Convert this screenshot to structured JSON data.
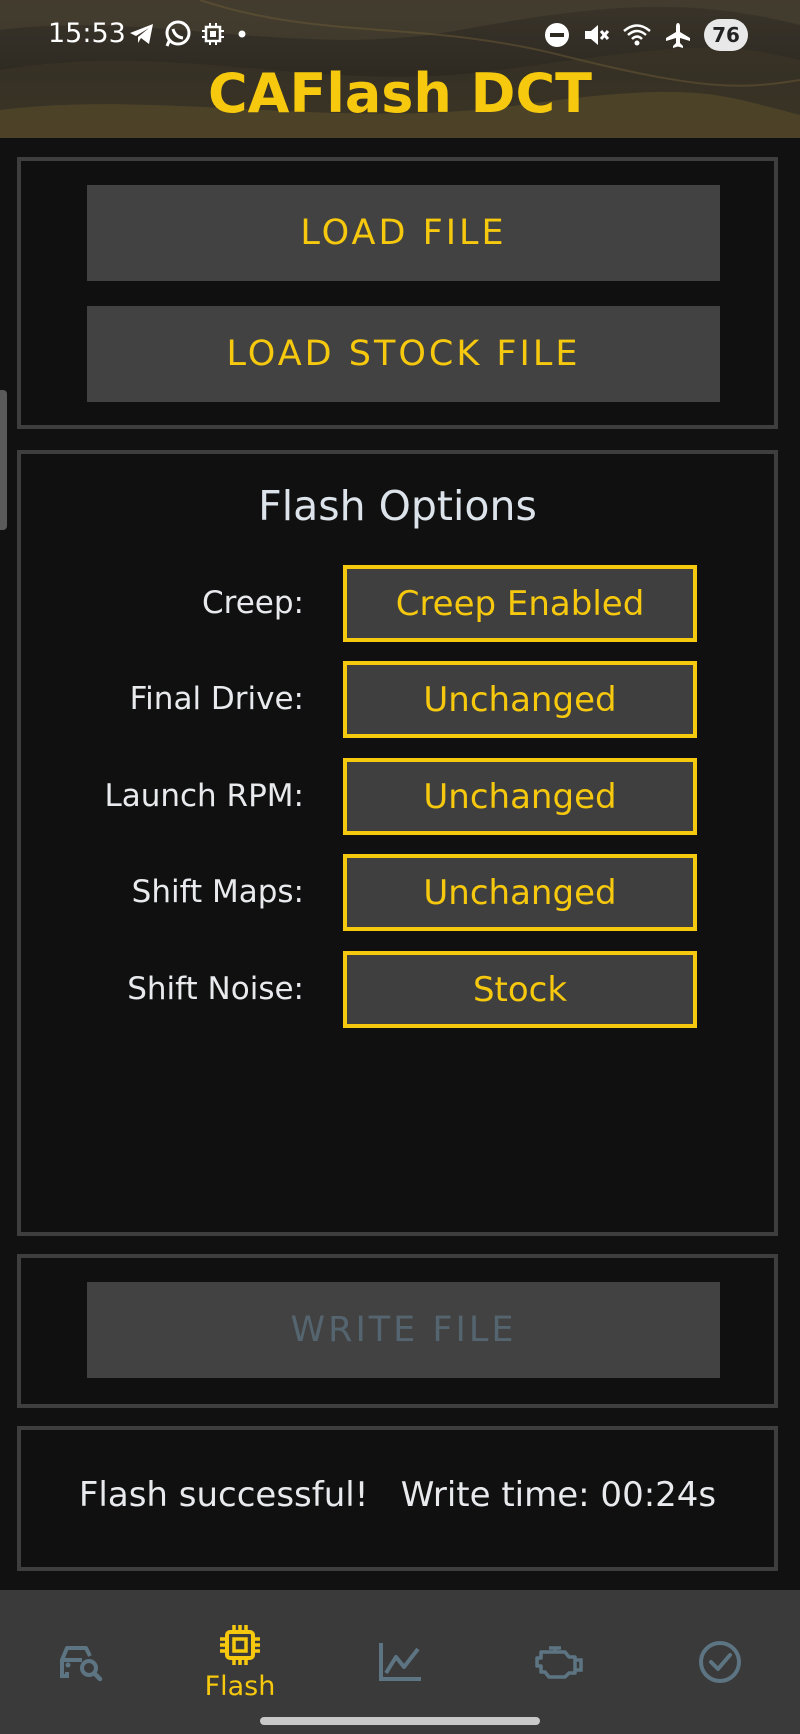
{
  "status_bar": {
    "time": "15:53",
    "battery": "76"
  },
  "app": {
    "title": "CAFlash DCT"
  },
  "file_panel": {
    "load_file": "LOAD FILE",
    "load_stock_file": "LOAD STOCK FILE"
  },
  "flash_options": {
    "title": "Flash Options",
    "options": [
      {
        "label": "Creep:",
        "value": "Creep Enabled"
      },
      {
        "label": "Final Drive:",
        "value": "Unchanged"
      },
      {
        "label": "Launch RPM:",
        "value": "Unchanged"
      },
      {
        "label": "Shift Maps:",
        "value": "Unchanged"
      },
      {
        "label": "Shift Noise:",
        "value": "Stock"
      }
    ]
  },
  "write_panel": {
    "write_file": "WRITE FILE"
  },
  "status_panel": {
    "message": "Flash successful!   Write time: 00:24s"
  },
  "bottom_nav": {
    "items": [
      {
        "icon": "car-search-icon",
        "label": ""
      },
      {
        "icon": "chip-icon",
        "label": "Flash"
      },
      {
        "icon": "chart-icon",
        "label": ""
      },
      {
        "icon": "engine-icon",
        "label": ""
      },
      {
        "icon": "check-circle-icon",
        "label": ""
      }
    ],
    "active_index": 1
  },
  "colors": {
    "accent": "#f6c90e",
    "inactive_icon": "#5d7482",
    "panel_border": "#3e3e3e",
    "button_bg": "#424242",
    "background": "#111111"
  }
}
